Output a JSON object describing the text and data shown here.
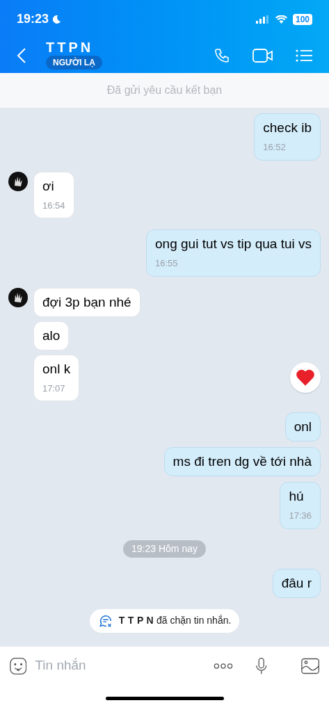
{
  "status_bar": {
    "time": "19:23",
    "battery": "100"
  },
  "header": {
    "title": "TTPN",
    "badge": "NGƯỜI LẠ"
  },
  "banner": {
    "text": "Đã gửi yêu cầu kết bạn"
  },
  "messages": [
    {
      "kind": "outgoing",
      "text": "check ib",
      "time": "16:52"
    },
    {
      "kind": "incoming",
      "avatar": true,
      "text": "ơi",
      "time": "16:54"
    },
    {
      "kind": "outgoing",
      "text": "ong gui tut vs tip qua tui vs",
      "time": "16:55"
    },
    {
      "kind": "incoming",
      "avatar": true,
      "text": "đợi 3p bạn nhé"
    },
    {
      "kind": "incoming",
      "avatar": false,
      "text": "alo"
    },
    {
      "kind": "incoming",
      "avatar": false,
      "text": "onl k",
      "time": "17:07",
      "react_button": true
    },
    {
      "kind": "outgoing",
      "text": "onl"
    },
    {
      "kind": "outgoing",
      "text": "ms đi tren dg về tới nhà"
    },
    {
      "kind": "outgoing",
      "text": "hú",
      "time": "17:36"
    },
    {
      "kind": "date",
      "text": "19:23 Hôm nay"
    },
    {
      "kind": "outgoing",
      "text": "đâu r"
    },
    {
      "kind": "notice",
      "name": "T T P N",
      "text": "đã chặn tin nhắn."
    }
  ],
  "composer": {
    "placeholder": "Tin nhắn"
  }
}
